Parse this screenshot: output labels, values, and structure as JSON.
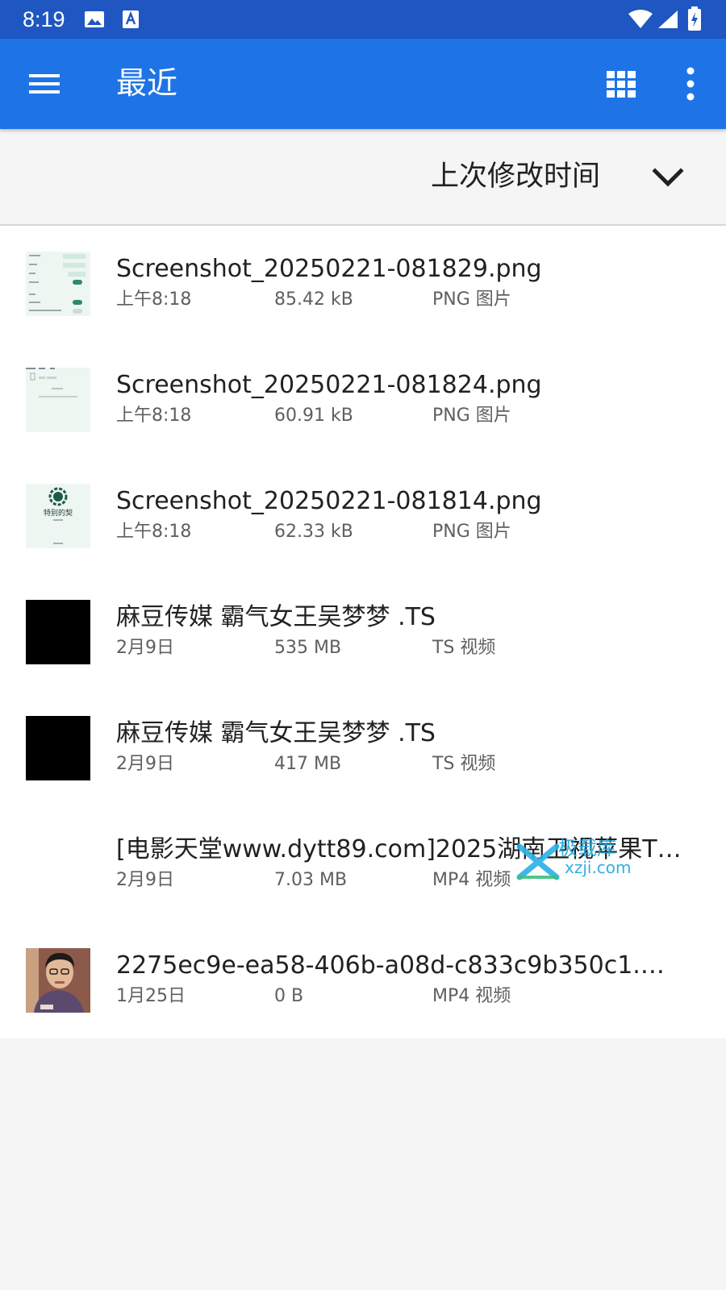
{
  "status_bar": {
    "time": "8:19"
  },
  "app_bar": {
    "title": "最近"
  },
  "sort": {
    "label": "上次修改时间"
  },
  "files": [
    {
      "name": "Screenshot_20250221-081829.png",
      "date": "上午8:18",
      "size": "85.42 kB",
      "type": "PNG 图片"
    },
    {
      "name": "Screenshot_20250221-081824.png",
      "date": "上午8:18",
      "size": "60.91 kB",
      "type": "PNG 图片"
    },
    {
      "name": "Screenshot_20250221-081814.png",
      "date": "上午8:18",
      "size": "62.33 kB",
      "type": "PNG 图片",
      "thumb_text": "特别的契"
    },
    {
      "name": "麻豆传媒 霸气女王吴梦梦 .TS",
      "date": "2月9日",
      "size": "535 MB",
      "type": "TS 视频"
    },
    {
      "name": "麻豆传媒 霸气女王吴梦梦 .TS",
      "date": "2月9日",
      "size": "417 MB",
      "type": "TS 视频"
    },
    {
      "name": "[电影天堂www.dytt89.com]2025湖南卫视苹果TV...",
      "date": "2月9日",
      "size": "7.03 MB",
      "type": "MP4 视频"
    },
    {
      "name": "2275ec9e-ea58-406b-a08d-c833c9b350c1.mp4",
      "date": "1月25日",
      "size": "0 B",
      "type": "MP4 视频"
    }
  ],
  "watermark": {
    "text": "极载库",
    "sub": "xzji.com"
  },
  "colors": {
    "status_bar": "#1f56c2",
    "app_bar": "#1e74e6",
    "background": "#f5f5f5",
    "list_background": "#ffffff",
    "primary_text": "#212121",
    "secondary_text": "#5f5f5f"
  }
}
